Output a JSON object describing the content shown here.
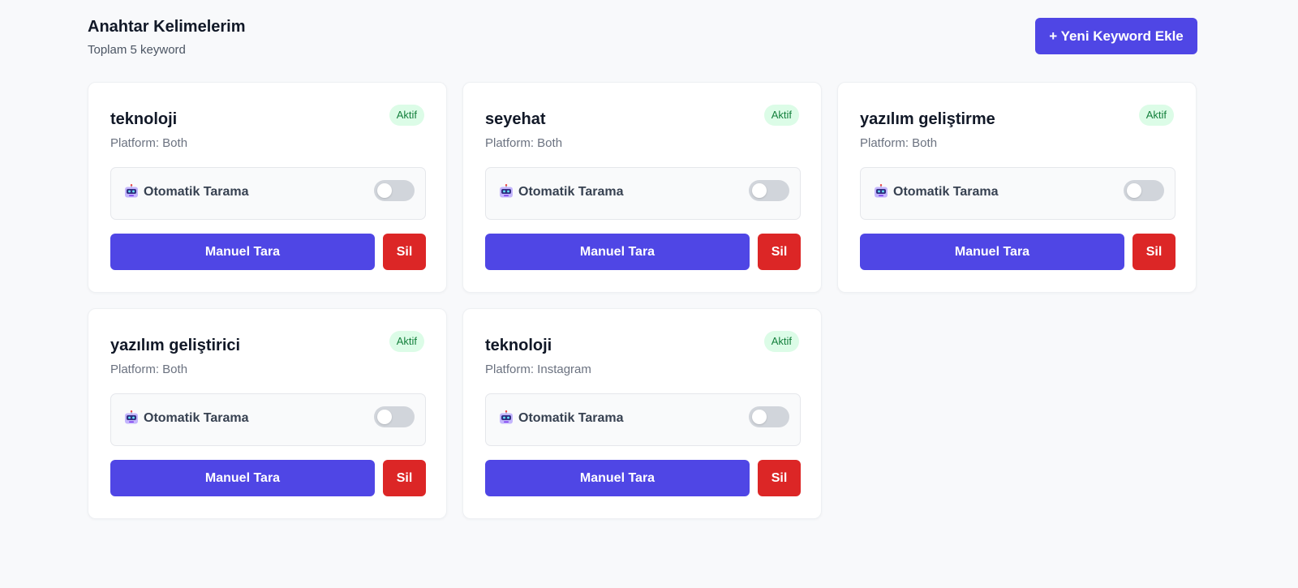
{
  "header": {
    "title": "Anahtar Kelimelerim",
    "subtitle": "Toplam 5 keyword",
    "add_button": "+ Yeni Keyword Ekle"
  },
  "colors": {
    "accent": "#4f46e5",
    "danger": "#dc2626",
    "badge_bg": "#dcfce7",
    "badge_text": "#15803d",
    "toggle_off": "#d1d5db"
  },
  "keywords": [
    {
      "title": "teknoloji",
      "platform": "Platform: Both",
      "status": "Aktif",
      "auto_label": "Otomatik Tarama",
      "auto_enabled": false,
      "scan_label": "Manuel Tara",
      "delete_label": "Sil",
      "icon": "robot-icon"
    },
    {
      "title": "seyehat",
      "platform": "Platform: Both",
      "status": "Aktif",
      "auto_label": "Otomatik Tarama",
      "auto_enabled": false,
      "scan_label": "Manuel Tara",
      "delete_label": "Sil",
      "icon": "robot-icon"
    },
    {
      "title": "yazılım geliştirme",
      "platform": "Platform: Both",
      "status": "Aktif",
      "auto_label": "Otomatik Tarama",
      "auto_enabled": false,
      "scan_label": "Manuel Tara",
      "delete_label": "Sil",
      "icon": "robot-icon"
    },
    {
      "title": "yazılım geliştirici",
      "platform": "Platform: Both",
      "status": "Aktif",
      "auto_label": "Otomatik Tarama",
      "auto_enabled": false,
      "scan_label": "Manuel Tara",
      "delete_label": "Sil",
      "icon": "robot-icon"
    },
    {
      "title": "teknoloji",
      "platform": "Platform: Instagram",
      "status": "Aktif",
      "auto_label": "Otomatik Tarama",
      "auto_enabled": false,
      "scan_label": "Manuel Tara",
      "delete_label": "Sil",
      "icon": "robot-icon"
    }
  ]
}
